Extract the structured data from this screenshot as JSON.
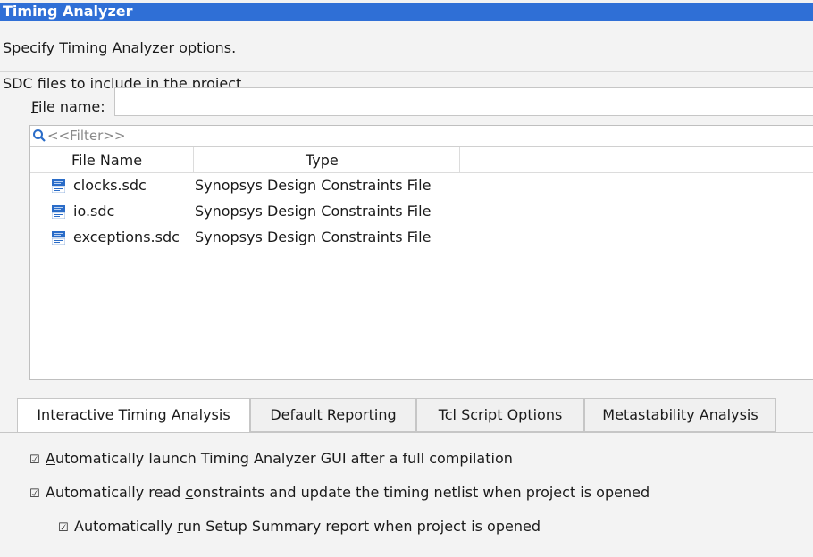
{
  "dialog": {
    "title": "Timing Analyzer",
    "description": "Specify Timing Analyzer options.",
    "section_label": "SDC files to include in the project"
  },
  "file_name": {
    "label_mnemonic": "F",
    "label_rest": "ile name:",
    "value": ""
  },
  "filter": {
    "placeholder": "<<Filter>>"
  },
  "table": {
    "columns": [
      "File Name",
      "Type"
    ],
    "rows": [
      {
        "name": "clocks.sdc",
        "type": "Synopsys Design Constraints File"
      },
      {
        "name": "io.sdc",
        "type": "Synopsys Design Constraints File"
      },
      {
        "name": "exceptions.sdc",
        "type": "Synopsys Design Constraints File"
      }
    ]
  },
  "tabs": [
    {
      "label": "Interactive Timing Analysis",
      "active": true
    },
    {
      "label": "Default Reporting",
      "active": false
    },
    {
      "label": "Tcl Script Options",
      "active": false
    },
    {
      "label": "Metastability Analysis",
      "active": false
    }
  ],
  "options": [
    {
      "checked": true,
      "pre": "",
      "mnemonic": "A",
      "post": "utomatically launch Timing Analyzer GUI after a full compilation"
    },
    {
      "checked": true,
      "pre": "Automatically read ",
      "mnemonic": "c",
      "post": "onstraints and update the timing netlist when project is opened"
    },
    {
      "checked": true,
      "pre": "Automatically ",
      "mnemonic": "r",
      "post": "un Setup Summary report when project is opened"
    }
  ],
  "checkmark_glyph": "☑",
  "colors": {
    "title_bar": "#2f6fd6",
    "panel_bg": "#f3f3f3",
    "file_icon_blue": "#2a6cc8"
  },
  "icons": {
    "filter": "search-icon",
    "file": "sdc-file-icon"
  }
}
